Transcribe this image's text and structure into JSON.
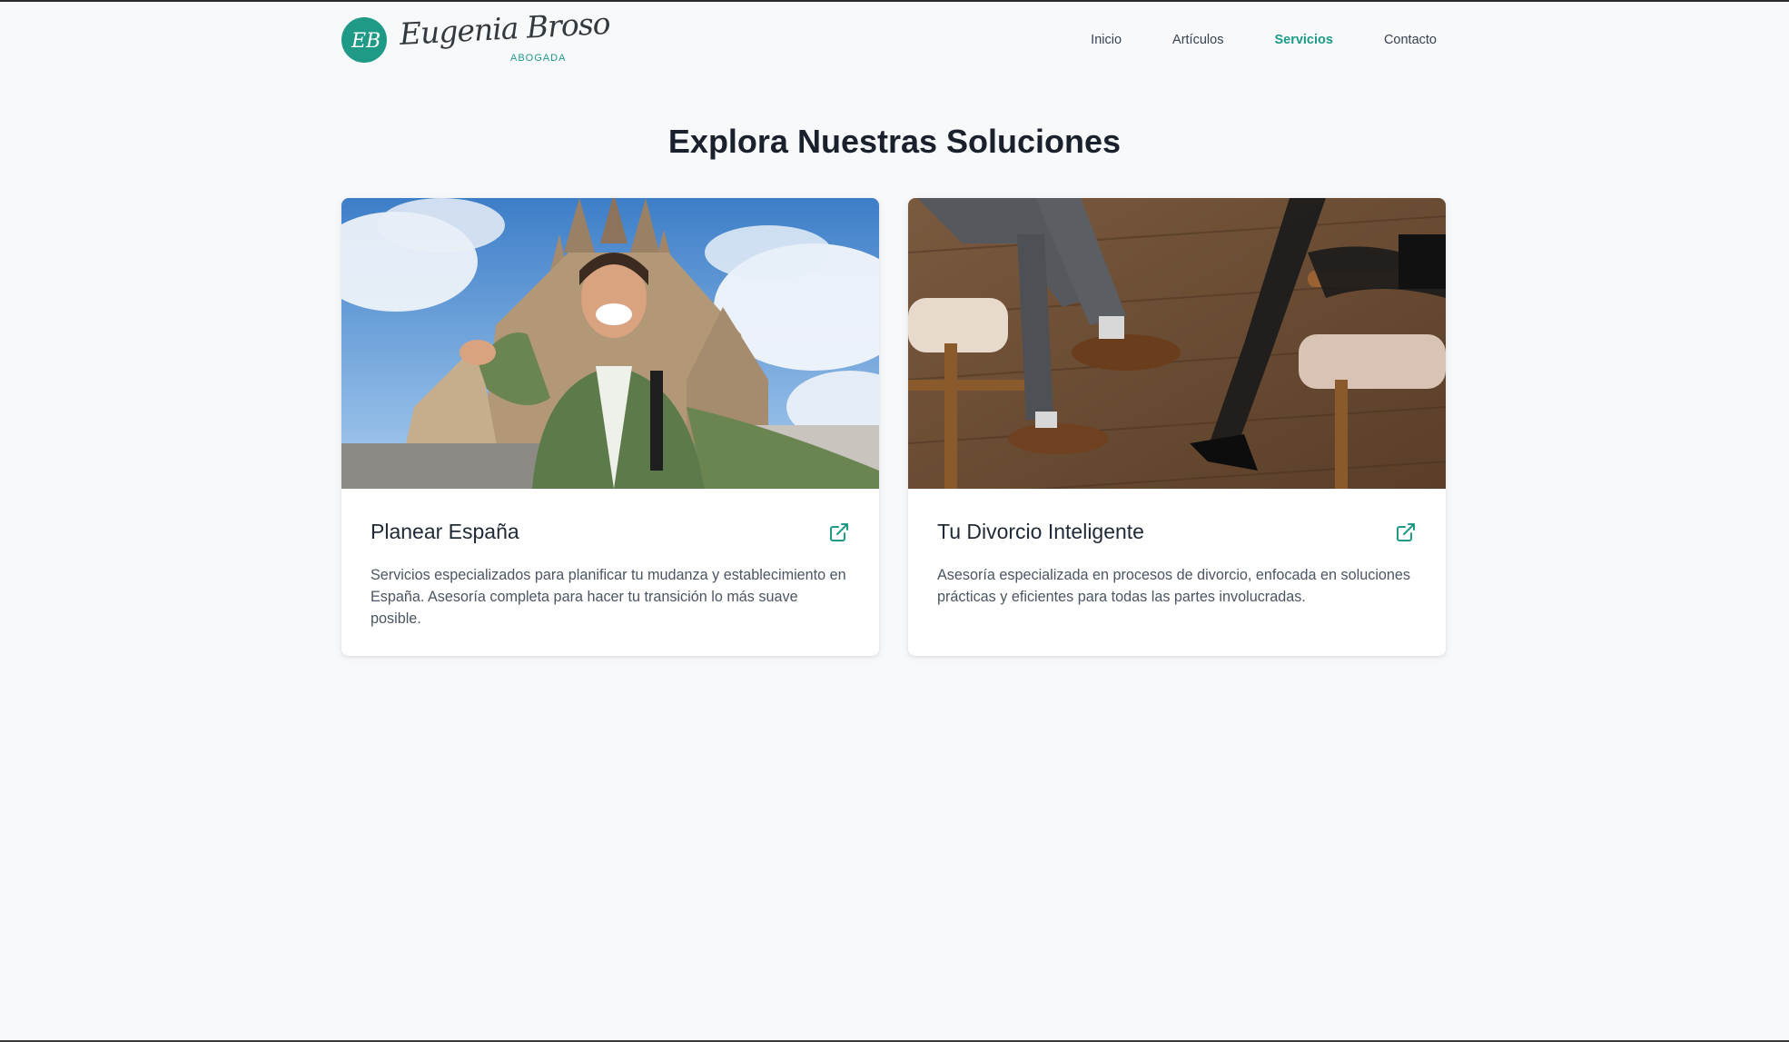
{
  "brand": {
    "monogram": "EB",
    "name": "Eugenia Broso",
    "subtitle": "ABOGADA",
    "accent_color": "#1f9a87"
  },
  "nav": {
    "items": [
      {
        "label": "Inicio",
        "active": false
      },
      {
        "label": "Artículos",
        "active": false
      },
      {
        "label": "Servicios",
        "active": true
      },
      {
        "label": "Contacto",
        "active": false
      }
    ]
  },
  "main": {
    "title": "Explora Nuestras Soluciones",
    "cards": [
      {
        "title": "Planear España",
        "description": "Servicios especializados para planificar tu mudanza y establecimiento en España. Asesoría completa para hacer tu transición lo más suave posible.",
        "image": "photo: smiling man taking a selfie in front of the Sagrada Família",
        "icon": "external-link-icon"
      },
      {
        "title": "Tu Divorcio Inteligente",
        "description": "Asesoría especializada en procesos de divorcio, enfocada en soluciones prácticas y eficientes para todas las partes involucradas.",
        "image": "photo: man and woman seated in wooden chairs, legs crossed, on a wood floor",
        "icon": "external-link-icon"
      }
    ]
  }
}
